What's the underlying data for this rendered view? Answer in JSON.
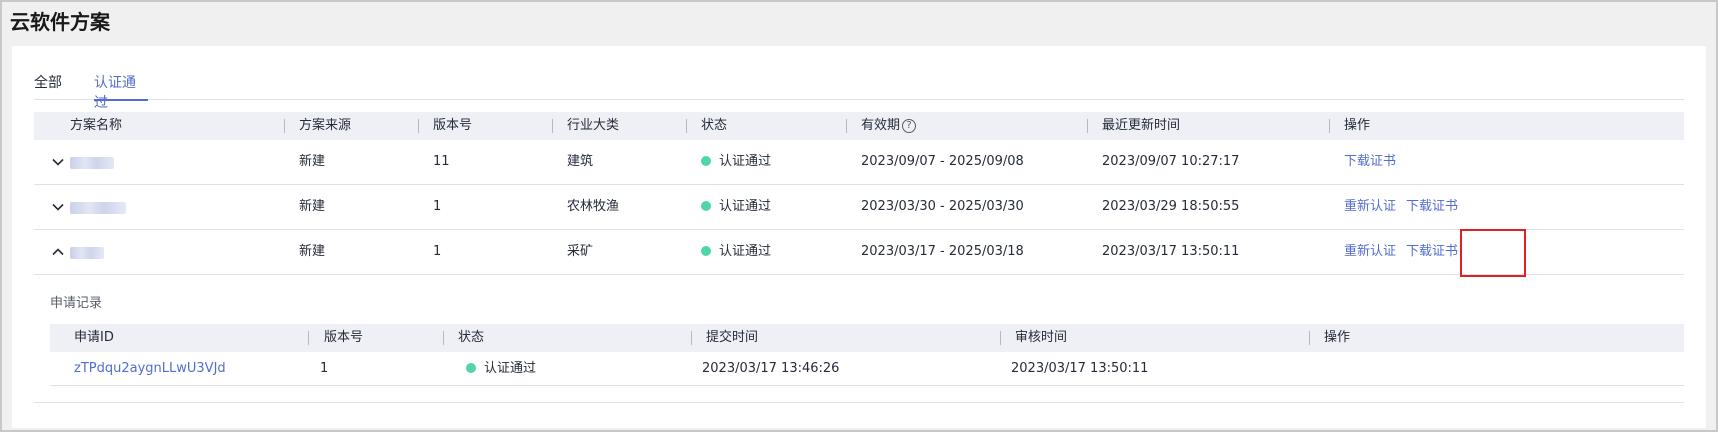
{
  "page": {
    "title": "云软件方案"
  },
  "tabs": [
    {
      "label": "全部",
      "active": false
    },
    {
      "label": "认证通过",
      "active": true
    }
  ],
  "table": {
    "columns": [
      "方案名称",
      "方案来源",
      "版本号",
      "行业大类",
      "状态",
      "有效期",
      "最近更新时间",
      "操作"
    ],
    "validity_help_icon": "help-circle-icon",
    "rows": [
      {
        "expand_icon": "chevron-down-icon",
        "source": "新建",
        "version": "11",
        "industry": "建筑",
        "status": "认证通过",
        "validity": "2023/09/07 - 2025/09/08",
        "updated": "2023/09/07 10:27:17",
        "actions": [
          "下载证书"
        ]
      },
      {
        "expand_icon": "chevron-down-icon",
        "source": "新建",
        "version": "1",
        "industry": "农林牧渔",
        "status": "认证通过",
        "validity": "2023/03/30 - 2025/03/30",
        "updated": "2023/03/29 18:50:55",
        "actions": [
          "重新认证",
          "下载证书"
        ]
      },
      {
        "expand_icon": "chevron-up-icon",
        "source": "新建",
        "version": "1",
        "industry": "采矿",
        "status": "认证通过",
        "validity": "2023/03/17 - 2025/03/18",
        "updated": "2023/03/17 13:50:11",
        "actions": [
          "重新认证",
          "下载证书"
        ]
      }
    ]
  },
  "sub_table": {
    "title": "申请记录",
    "columns": [
      "申请ID",
      "版本号",
      "状态",
      "提交时间",
      "审核时间",
      "操作"
    ],
    "rows": [
      {
        "id": "zTPdqu2aygnLLwU3VJd",
        "version": "1",
        "status": "认证通过",
        "submitted": "2023/03/17 13:46:26",
        "reviewed": "2023/03/17 13:50:11"
      }
    ]
  },
  "colors": {
    "accent": "#526ecc",
    "status_success": "#50d4ab",
    "highlight": "#e02020"
  }
}
